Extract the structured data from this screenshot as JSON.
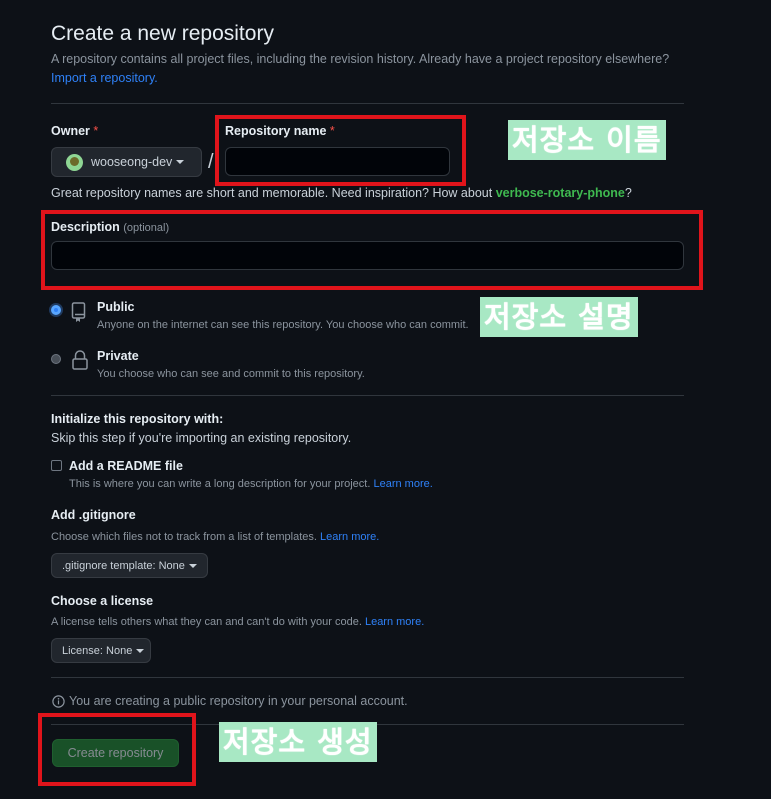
{
  "header": {
    "title": "Create a new repository",
    "description": "A repository contains all project files, including the revision history. Already have a project repository elsewhere?",
    "import_link": "Import a repository."
  },
  "owner": {
    "label": "Owner",
    "required_mark": "*",
    "selected": "wooseong-dev",
    "separator": "/"
  },
  "repo_name": {
    "label": "Repository name",
    "required_mark": "*",
    "value": "",
    "hint_prefix": "Great repository names are short and memorable. Need inspiration? How about",
    "suggestion": "verbose-rotary-phone",
    "hint_suffix": "?"
  },
  "description": {
    "label": "Description",
    "optional": "(optional)",
    "value": ""
  },
  "visibility": {
    "public": {
      "label": "Public",
      "desc": "Anyone on the internet can see this repository. You choose who can commit.",
      "selected": true
    },
    "private": {
      "label": "Private",
      "desc": "You choose who can see and commit to this repository.",
      "selected": false
    }
  },
  "init": {
    "heading": "Initialize this repository with:",
    "subheading": "Skip this step if you're importing an existing repository.",
    "readme": {
      "label": "Add a README file",
      "desc": "This is where you can write a long description for your project.",
      "learn_more": "Learn more.",
      "checked": false
    },
    "gitignore": {
      "heading": "Add .gitignore",
      "desc": "Choose which files not to track from a list of templates.",
      "learn_more": "Learn more.",
      "button": ".gitignore template: None"
    },
    "license": {
      "heading": "Choose a license",
      "desc": "A license tells others what they can and can't do with your code.",
      "learn_more": "Learn more.",
      "button": "License: None"
    }
  },
  "notice": "You are creating a public repository in your personal account.",
  "submit_label": "Create repository",
  "annotations": {
    "repo_name": "저장소 이름",
    "description": "저장소 설명",
    "create": "저장소 생성"
  },
  "colors": {
    "background": "#0d1117",
    "link": "#2f81f7",
    "suggestion": "#3fb950",
    "required": "#f85149",
    "primary_button": "#238636",
    "annotation_box": "#e0141b",
    "annotation_label_bg": "#a8e8c4"
  },
  "icons": {
    "info": "info-icon",
    "public": "repo-icon",
    "private": "lock-icon"
  }
}
